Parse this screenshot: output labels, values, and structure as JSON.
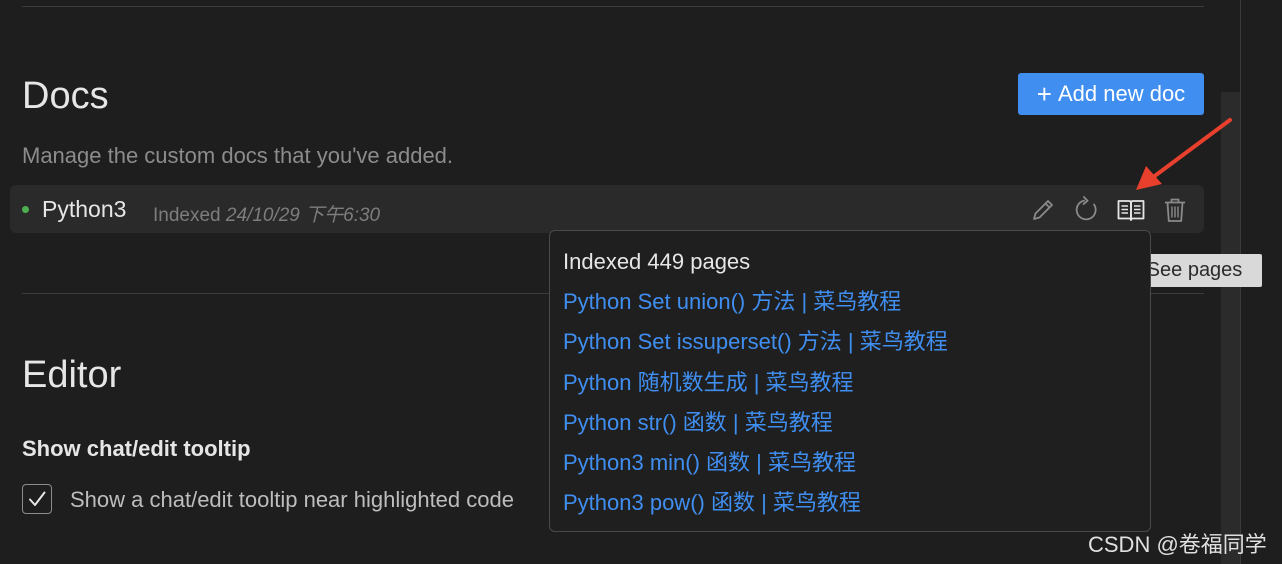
{
  "docs": {
    "title": "Docs",
    "subtitle": "Manage the custom docs that you've added.",
    "add_button": {
      "icon": "plus-icon",
      "label": "Add new doc"
    },
    "items": [
      {
        "name": "Python3",
        "status_color": "#4caf50",
        "indexed_label": "Indexed",
        "indexed_date": "24/10/29 下午6:30",
        "actions": [
          "edit-pencil-icon",
          "refresh-icon",
          "book-icon",
          "trash-icon"
        ]
      }
    ]
  },
  "tooltip": {
    "text": "See pages"
  },
  "pages_popover": {
    "title": "Indexed 449 pages",
    "pages": [
      "Python Set union() 方法 | 菜鸟教程",
      "Python Set issuperset() 方法 | 菜鸟教程",
      "Python 随机数生成 | 菜鸟教程",
      "Python str() 函数 | 菜鸟教程",
      "Python3 min() 函数 | 菜鸟教程",
      "Python3 pow() 函数 | 菜鸟教程"
    ]
  },
  "editor": {
    "title": "Editor",
    "setting_label": "Show chat/edit tooltip",
    "checkbox": {
      "checked": true,
      "label": "Show a chat/edit tooltip near highlighted code"
    }
  },
  "watermark": "CSDN @卷福同学",
  "colors": {
    "background": "#1e1e1e",
    "accent": "#3f8ef0",
    "annotation_arrow": "#e8402c"
  }
}
